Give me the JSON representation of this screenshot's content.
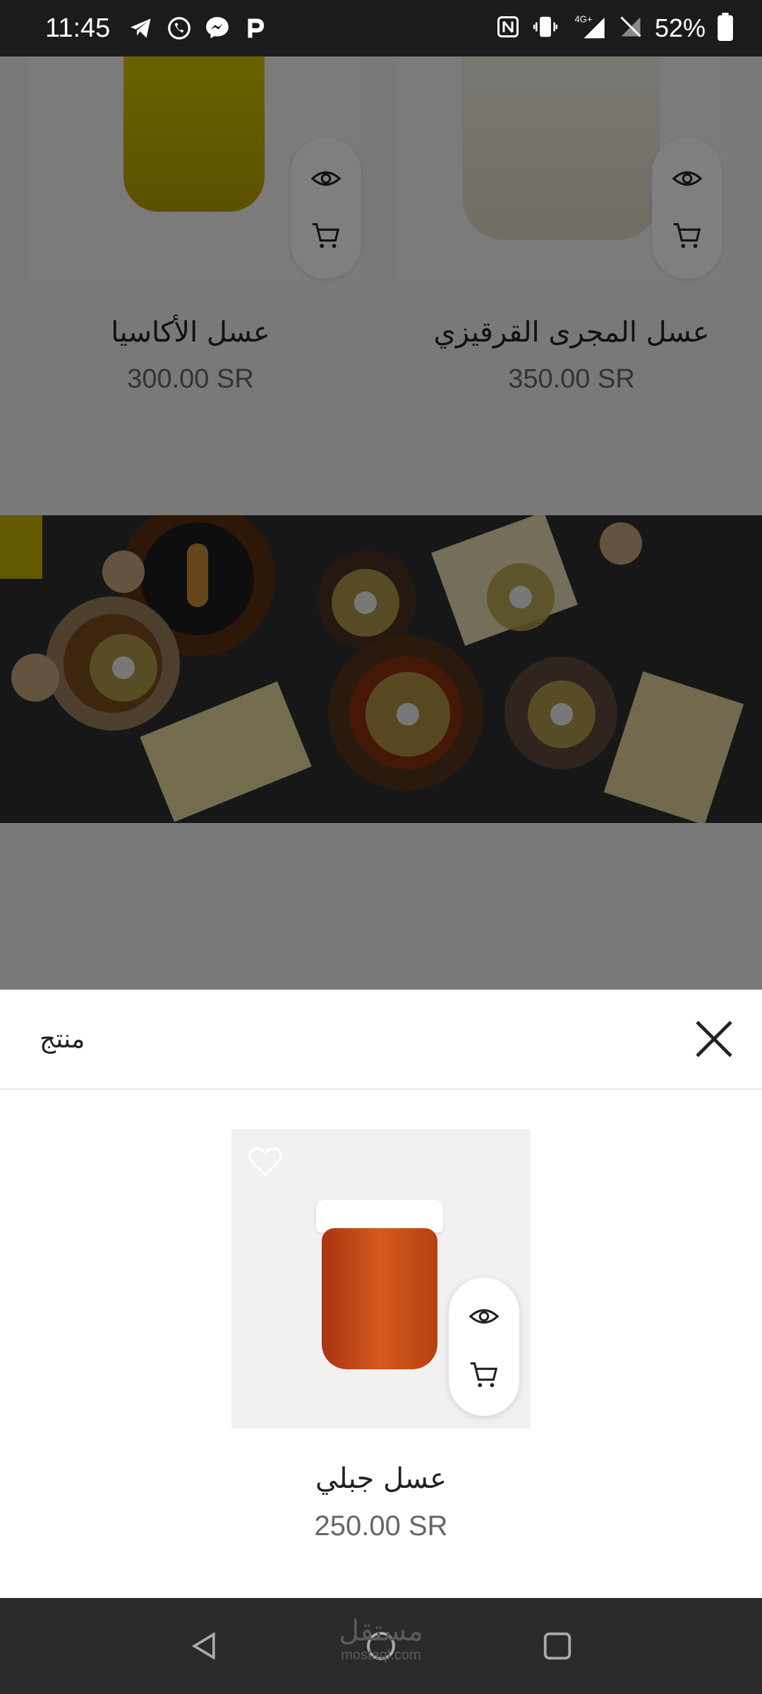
{
  "status_bar": {
    "time": "11:45",
    "battery_percent": "52%",
    "network": "4G+",
    "app_icons": [
      "telegram-icon",
      "whatsapp-icon",
      "messenger-icon",
      "p-app-icon"
    ],
    "system_icons": [
      "nfc-icon",
      "vibrate-icon",
      "signal-icon",
      "no-sim-icon",
      "battery-icon"
    ]
  },
  "products": [
    {
      "name": "عسل المجرى القرقيزي",
      "price": "350.00 SR"
    },
    {
      "name": "عسل الأكاسيا",
      "price": "300.00 SR"
    }
  ],
  "sheet": {
    "title": "منتج",
    "product_name": "عسل جبلي",
    "product_price": "250.00 SR"
  },
  "watermark": {
    "arabic": "مستقل",
    "latin": "mostaql.com"
  },
  "colors": {
    "status_bar": "#1b1b1b",
    "overlay": "rgba(0,0,0,0.5)",
    "sheet_bg": "#ffffff",
    "nav_bar": "#2a2a2a",
    "price": "#666666"
  }
}
